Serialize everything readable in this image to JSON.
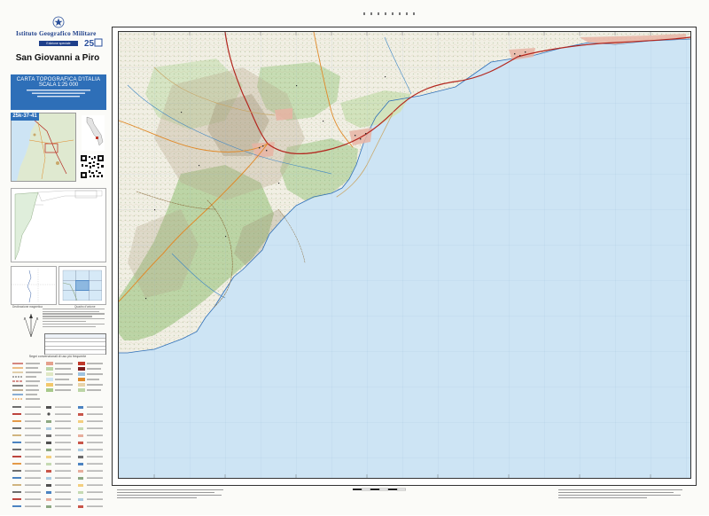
{
  "publisher": {
    "name": "Istituto Geografico Militare",
    "sub_label": "Edizione speciale"
  },
  "sheet": {
    "title": "San Giovanni a Piro",
    "series_line1": "CARTA TOPOGRAFICA D'ITALIA",
    "series_line2": "SCALA 1:25 000",
    "code": "25k-37-41"
  },
  "colors": {
    "sea": "#cde4f4",
    "land_light": "#f4f1e6",
    "forest": "#bcd5a6",
    "relief": "#cfc7b2",
    "road_red": "#b3261e",
    "road_orange": "#e08a2a",
    "panel_blue": "#2e6fb8",
    "igm_navy": "#1e3f8a"
  },
  "legend": {
    "title": "Segni convenzionali di uso più frequente"
  },
  "captions": {
    "declination": "Declinazione magnetica",
    "sheet_index": "Quadro d'unione"
  }
}
